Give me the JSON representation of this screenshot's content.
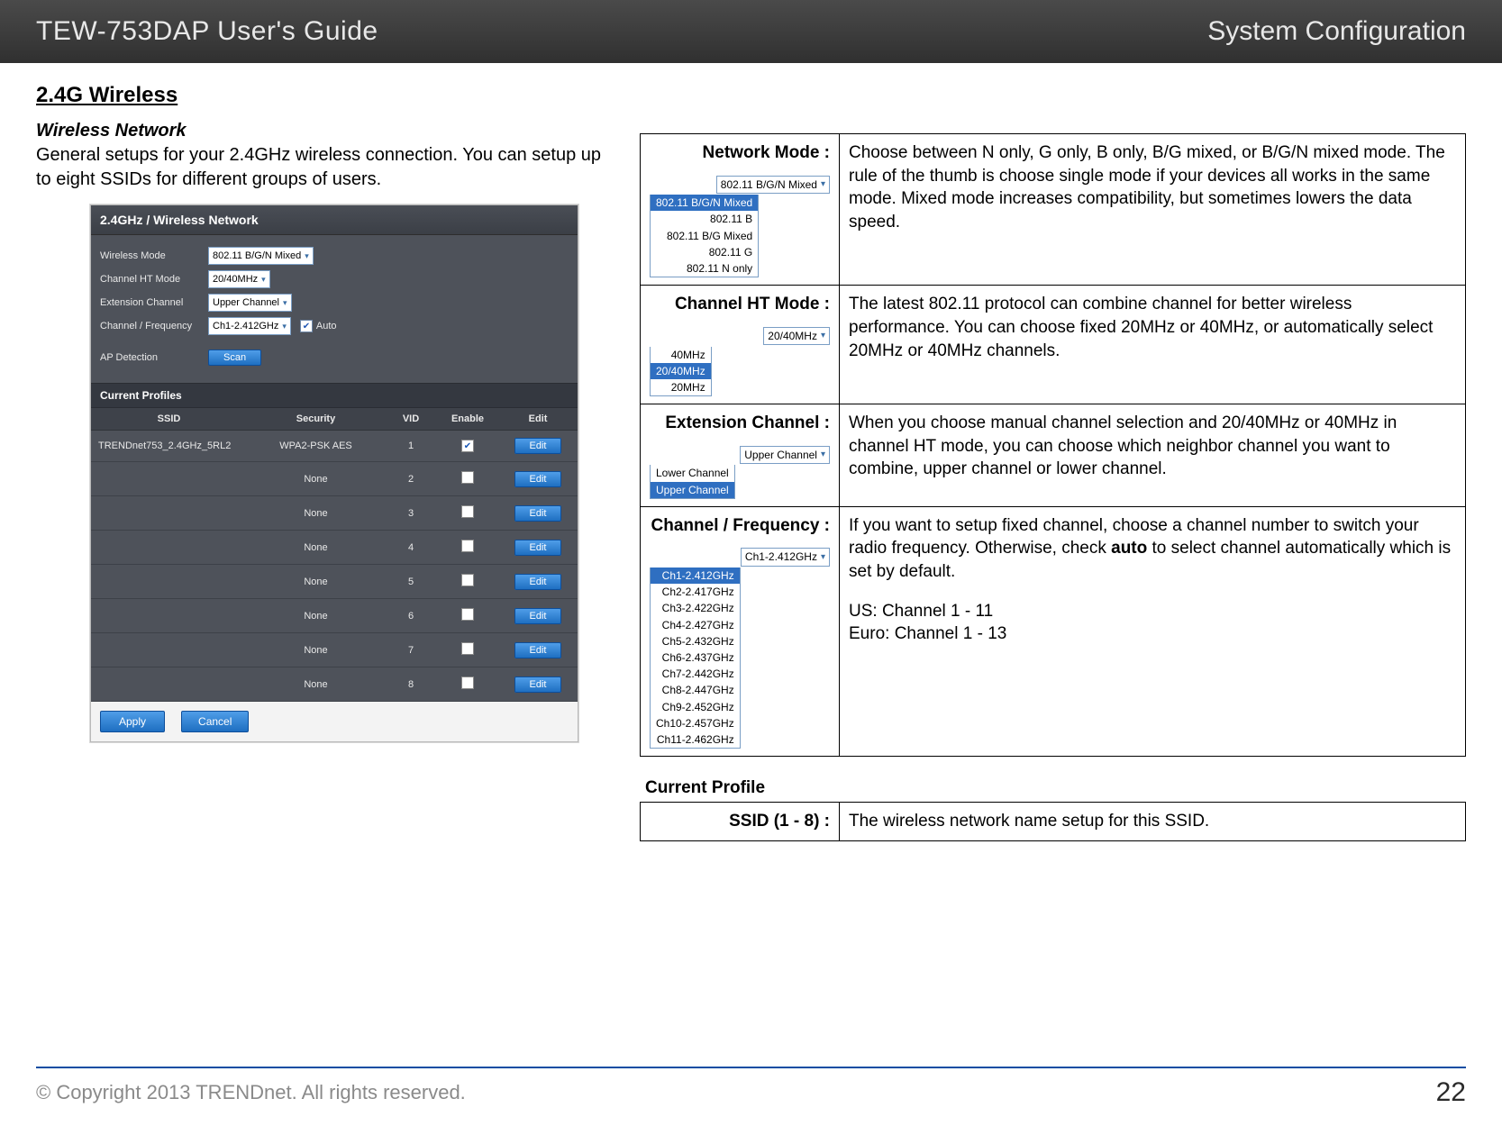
{
  "header": {
    "title": "TEW-753DAP User's Guide",
    "section": "System Configuration"
  },
  "left": {
    "h1": "2.4G Wireless",
    "h2": "Wireless Network",
    "intro": "General setups for your 2.4GHz wireless connection. You can setup up to eight SSIDs for different groups of users.",
    "shot": {
      "title": "2.4GHz / Wireless Network",
      "rows": {
        "wireless_mode": {
          "label": "Wireless Mode",
          "value": "802.11 B/G/N Mixed"
        },
        "ht_mode": {
          "label": "Channel HT Mode",
          "value": "20/40MHz"
        },
        "ext_ch": {
          "label": "Extension Channel",
          "value": "Upper Channel"
        },
        "ch_freq": {
          "label": "Channel / Frequency",
          "value": "Ch1-2.412GHz",
          "auto": "Auto"
        },
        "ap_det": {
          "label": "AP Detection",
          "scan": "Scan"
        }
      },
      "profiles_title": "Current Profiles",
      "cols": {
        "ssid": "SSID",
        "sec": "Security",
        "vid": "VID",
        "en": "Enable",
        "ed": "Edit"
      },
      "rows_data": [
        {
          "ssid": "TRENDnet753_2.4GHz_5RL2",
          "sec": "WPA2-PSK AES",
          "vid": "1",
          "en": true
        },
        {
          "ssid": "",
          "sec": "None",
          "vid": "2",
          "en": false
        },
        {
          "ssid": "",
          "sec": "None",
          "vid": "3",
          "en": false
        },
        {
          "ssid": "",
          "sec": "None",
          "vid": "4",
          "en": false
        },
        {
          "ssid": "",
          "sec": "None",
          "vid": "5",
          "en": false
        },
        {
          "ssid": "",
          "sec": "None",
          "vid": "6",
          "en": false
        },
        {
          "ssid": "",
          "sec": "None",
          "vid": "7",
          "en": false
        },
        {
          "ssid": "",
          "sec": "None",
          "vid": "8",
          "en": false
        }
      ],
      "edit": "Edit",
      "apply": "Apply",
      "cancel": "Cancel"
    }
  },
  "right": {
    "rows": [
      {
        "label": "Network Mode :",
        "dd_sel": "802.11 B/G/N Mixed",
        "dd_opts": [
          "802.11 B/G/N Mixed",
          "802.11 B",
          "802.11 B/G Mixed",
          "802.11 G",
          "802.11 N only"
        ],
        "dd_hl": 0,
        "desc": "Choose between N only, G only, B only, B/G mixed, or B/G/N mixed mode. The rule of the thumb is choose single mode if your devices all works in the same mode. Mixed mode increases compatibility, but sometimes lowers the data speed."
      },
      {
        "label": "Channel HT Mode :",
        "dd_sel": "20/40MHz",
        "dd_opts": [
          "40MHz",
          "20/40MHz",
          "20MHz"
        ],
        "dd_hl": 1,
        "desc": "The latest 802.11 protocol can combine channel for better wireless performance. You can choose fixed 20MHz or 40MHz, or automatically select 20MHz or 40MHz channels."
      },
      {
        "label": "Extension Channel :",
        "dd_sel": "Upper Channel",
        "dd_opts": [
          "Lower Channel",
          "Upper Channel"
        ],
        "dd_hl": 1,
        "desc": "When you choose manual channel selection and 20/40MHz or 40MHz in channel HT mode, you can choose which neighbor channel you want to combine, upper channel or lower channel."
      },
      {
        "label": "Channel / Frequency :",
        "dd_sel": "Ch1-2.412GHz",
        "dd_opts": [
          "Ch1-2.412GHz",
          "Ch2-2.417GHz",
          "Ch3-2.422GHz",
          "Ch4-2.427GHz",
          "Ch5-2.432GHz",
          "Ch6-2.437GHz",
          "Ch7-2.442GHz",
          "Ch8-2.447GHz",
          "Ch9-2.452GHz",
          "Ch10-2.457GHz",
          "Ch11-2.462GHz"
        ],
        "dd_hl": 0,
        "desc_pre": "If you want to setup fixed channel, choose a channel number to switch your radio frequency. Otherwise,  check ",
        "desc_bold": "auto",
        "desc_post": " to select channel automatically which is set by default.",
        "extra1": "US: Channel 1 - 11",
        "extra2": "Euro: Channel 1 - 13"
      }
    ],
    "cp_heading": "Current Profile",
    "cp_row": {
      "label": "SSID (1 - 8) :",
      "desc": "The wireless network name setup for this SSID."
    }
  },
  "footer": {
    "copyright": "© Copyright 2013 TRENDnet. All rights reserved.",
    "page": "22"
  }
}
